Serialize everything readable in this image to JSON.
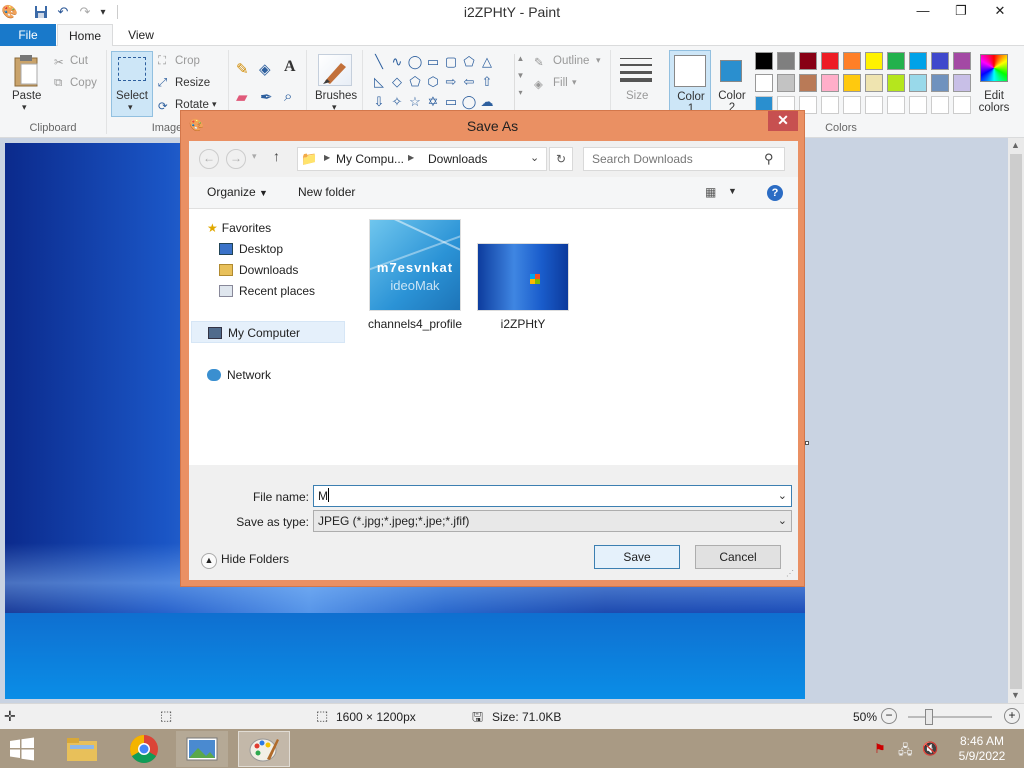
{
  "window": {
    "title": "i2ZPHtY - Paint",
    "min_glyph": "—",
    "max_glyph": "❐",
    "close_glyph": "✕"
  },
  "tabs": {
    "file": "File",
    "home": "Home",
    "view": "View"
  },
  "ribbon": {
    "clipboard": {
      "paste": "Paste",
      "cut": "Cut",
      "copy": "Copy",
      "group": "Clipboard"
    },
    "image": {
      "select": "Select",
      "crop": "Crop",
      "resize": "Resize",
      "rotate": "Rotate",
      "group": "Image"
    },
    "tools": {
      "brushes": "Brushes"
    },
    "shapes": {
      "outline": "Outline",
      "fill": "Fill"
    },
    "size": "Size",
    "color1": "Color 1",
    "color2": "Color 2",
    "edit_colors": "Edit colors",
    "colors_group": "Colors",
    "palette_top": [
      "#000000",
      "#7f7f7f",
      "#880015",
      "#ed1c24",
      "#ff7f27",
      "#fff200",
      "#22b14c",
      "#00a2e8",
      "#3f48cc",
      "#a349a4"
    ],
    "palette_mid": [
      "#ffffff",
      "#c3c3c3",
      "#b97a57",
      "#ffaec9",
      "#ffc90e",
      "#efe4b0",
      "#b5e61d",
      "#99d9ea",
      "#7092be",
      "#c8bfe7"
    ],
    "color1_value": "#ffffff",
    "color2_value": "#2a8fcf"
  },
  "dialog": {
    "title": "Save As",
    "breadcrumb": {
      "root": "My Compu...",
      "current": "Downloads"
    },
    "search_placeholder": "Search Downloads",
    "organize": "Organize",
    "new_folder": "New folder",
    "nav": {
      "favorites": "Favorites",
      "desktop": "Desktop",
      "downloads": "Downloads",
      "recent": "Recent places",
      "my_computer": "My Computer",
      "network": "Network"
    },
    "files": [
      {
        "name": "channels4_profile"
      },
      {
        "name": "i2ZPHtY"
      }
    ],
    "thumb_text": {
      "line1": "m7esvnkat",
      "line2": "ideoMak"
    },
    "file_name_label": "File name:",
    "file_name_value": "M",
    "save_type_label": "Save as type:",
    "save_type_value": "JPEG (*.jpg;*.jpeg;*.jpe;*.jfif)",
    "hide_folders": "Hide Folders",
    "save": "Save",
    "cancel": "Cancel"
  },
  "status": {
    "dimensions": "1600 × 1200px",
    "size": "Size: 71.0KB",
    "zoom": "50%",
    "zoom_level": 0.5
  },
  "taskbar": {
    "time": "8:46 AM",
    "date": "5/9/2022"
  }
}
